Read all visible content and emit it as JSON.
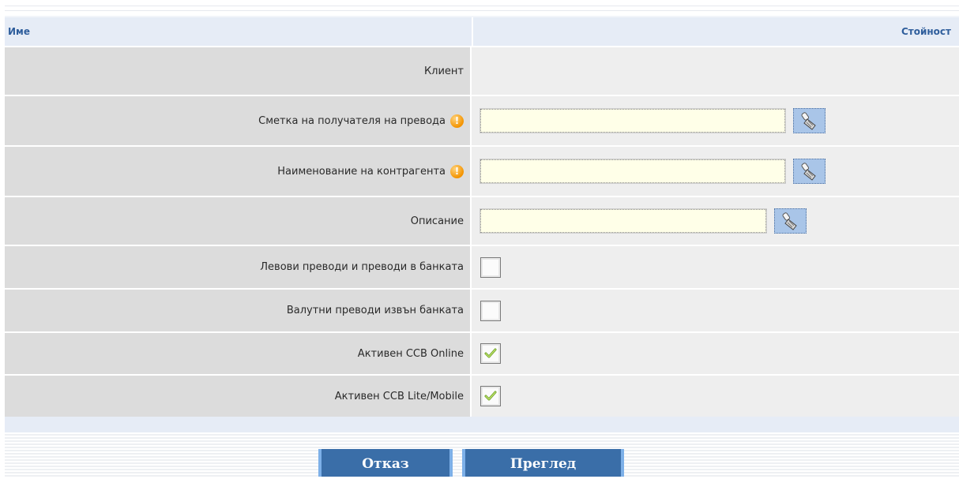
{
  "page": {
    "title_fragment": ""
  },
  "table": {
    "header": {
      "name": "Име",
      "value": "Стойност"
    },
    "rows": [
      {
        "label": "Клиент",
        "type": "static"
      },
      {
        "label": "Сметка на получателя на превода",
        "type": "input",
        "required": true,
        "value": ""
      },
      {
        "label": "Наименование на контрагента",
        "type": "input",
        "required": true,
        "value": ""
      },
      {
        "label": "Описание",
        "type": "input",
        "required": false,
        "value": ""
      },
      {
        "label": "Левови преводи и преводи в банката",
        "type": "checkbox",
        "checked": false
      },
      {
        "label": "Валутни преводи извън банката",
        "type": "checkbox",
        "checked": false
      },
      {
        "label": "Активен CCB Online",
        "type": "checkbox",
        "checked": true
      },
      {
        "label": "Активен CCB Lite/Mobile",
        "type": "checkbox",
        "checked": true
      }
    ]
  },
  "icons": {
    "required": "exclamation-icon",
    "clear": "broom-icon",
    "check": "checkmark-icon"
  },
  "buttons": {
    "cancel": "Отказ",
    "preview": "Преглед"
  },
  "colors": {
    "header_text": "#2f5e9c",
    "button_bg": "#3a6ea8",
    "input_bg": "#ffffe8",
    "warning": "#f39300"
  }
}
